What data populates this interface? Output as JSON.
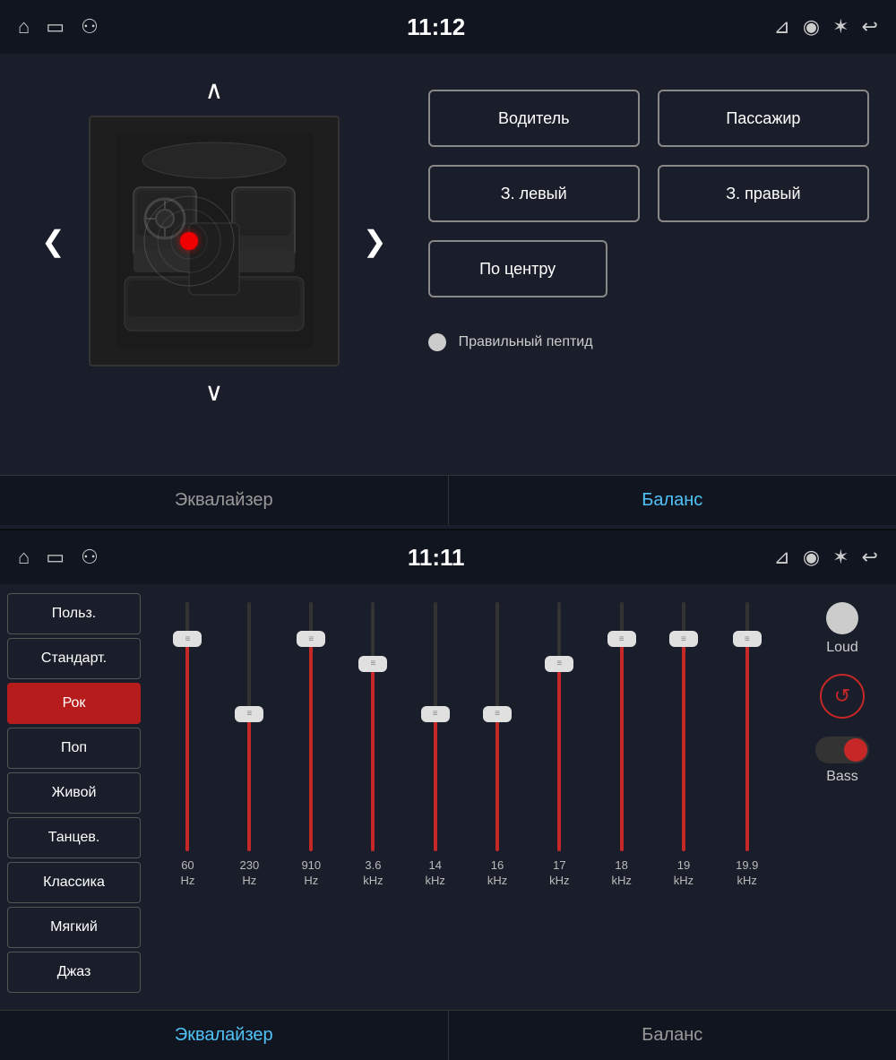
{
  "top": {
    "statusBar": {
      "time": "11:12",
      "icons_left": [
        "home",
        "screen",
        "usb"
      ],
      "icons_right": [
        "cast",
        "location",
        "bluetooth",
        "back"
      ]
    },
    "buttons": {
      "driver": "Водитель",
      "passenger": "Пассажир",
      "rear_left": "З. левый",
      "rear_right": "З. правый",
      "center": "По центру"
    },
    "subtitle": "Правильный пептид",
    "tabs": {
      "equalizer": "Эквалайзер",
      "balance": "Баланс"
    }
  },
  "bottom": {
    "statusBar": {
      "time": "11:11"
    },
    "presets": [
      {
        "label": "Польз.",
        "selected": false
      },
      {
        "label": "Стандарт.",
        "selected": false
      },
      {
        "label": "Рок",
        "selected": true
      },
      {
        "label": "Поп",
        "selected": false
      },
      {
        "label": "Живой",
        "selected": false
      },
      {
        "label": "Танцев.",
        "selected": false
      },
      {
        "label": "Классика",
        "selected": false
      },
      {
        "label": "Мягкий",
        "selected": false
      },
      {
        "label": "Джаз",
        "selected": false
      }
    ],
    "sliders": [
      {
        "freq": "60",
        "unit": "Hz",
        "fill": 85
      },
      {
        "freq": "230",
        "unit": "Hz",
        "fill": 55
      },
      {
        "freq": "910",
        "unit": "Hz",
        "fill": 85
      },
      {
        "freq": "3.6",
        "unit": "kHz",
        "fill": 75
      },
      {
        "freq": "14",
        "unit": "kHz",
        "fill": 55
      },
      {
        "freq": "16",
        "unit": "kHz",
        "fill": 55
      },
      {
        "freq": "17",
        "unit": "kHz",
        "fill": 75
      },
      {
        "freq": "18",
        "unit": "kHz",
        "fill": 85
      },
      {
        "freq": "19",
        "unit": "kHz",
        "fill": 85
      },
      {
        "freq": "19.9",
        "unit": "kHz",
        "fill": 85
      }
    ],
    "controls": {
      "loud": "Loud",
      "bass": "Bass",
      "reset": "↺"
    },
    "tabs": {
      "equalizer": "Эквалайзер",
      "balance": "Баланс",
      "equalizer_active": true
    }
  }
}
